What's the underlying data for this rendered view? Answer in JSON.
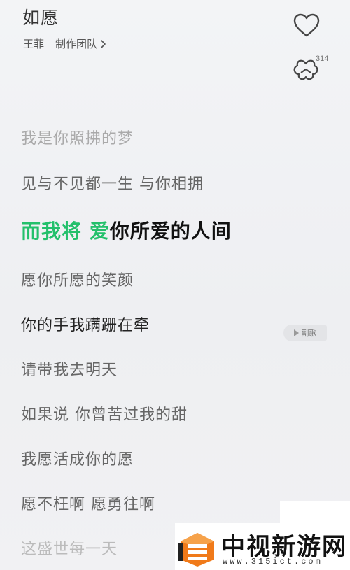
{
  "header": {
    "title": "如愿",
    "artist": "王菲",
    "team_link": "制作团队",
    "comment_count": "314"
  },
  "lyrics": {
    "lines": [
      "我是你照拂的梦",
      "见与不见都一生 与你相拥",
      "愿你所愿的笑颜",
      "你的手我蹒跚在牵",
      "请带我去明天",
      "如果说 你曾苦过我的甜",
      "我愿活成你的愿",
      "愿不枉啊 愿勇往啊",
      "这盛世每一天"
    ],
    "current_sung": "而我将 爱",
    "current_rest": "你所爱的人间",
    "chorus_tag": "副歌"
  },
  "watermark": {
    "name": "中视新游网",
    "url": "www.315ict.com"
  },
  "colors": {
    "sung_highlight": "#23c06b",
    "logo_orange": "#f07a1a"
  }
}
